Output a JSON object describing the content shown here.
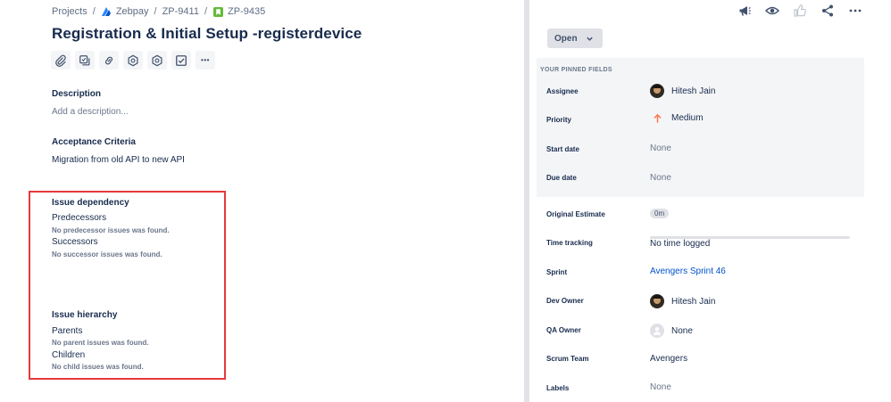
{
  "breadcrumb": {
    "projects": "Projects",
    "project": "Zebpay",
    "parent_key": "ZP-9411",
    "issue_key": "ZP-9435",
    "separator": "/"
  },
  "issue": {
    "title": "Registration & Initial Setup -registerdevice"
  },
  "toolbar": {
    "icons": [
      "paperclip-icon",
      "child-issue-icon",
      "link-icon",
      "hexagon-icon",
      "hexagon-icon",
      "checkbox-icon",
      "more-icon"
    ],
    "more_label": "•••"
  },
  "description": {
    "heading": "Description",
    "placeholder": "Add a description..."
  },
  "acceptance": {
    "heading": "Acceptance Criteria",
    "text": "Migration from old API to new API"
  },
  "dependency": {
    "heading": "Issue dependency",
    "predecessors_label": "Predecessors",
    "predecessors_note": "No predecessor issues was found.",
    "successors_label": "Successors",
    "successors_note": "No successor issues was found."
  },
  "hierarchy": {
    "heading": "Issue hierarchy",
    "parents_label": "Parents",
    "parents_note": "No parent issues was found.",
    "children_label": "Children",
    "children_note": "No child issues was found."
  },
  "header_icons": [
    "megaphone-icon",
    "eye-icon",
    "thumbs-up-icon",
    "share-icon",
    "more-icon"
  ],
  "status": {
    "label": "Open"
  },
  "pinned": {
    "header": "YOUR PINNED FIELDS"
  },
  "fields": {
    "assignee": {
      "label": "Assignee",
      "value": "Hitesh Jain"
    },
    "priority": {
      "label": "Priority",
      "value": "Medium",
      "icon_color": "#ff7452"
    },
    "start_date": {
      "label": "Start date",
      "value": "None"
    },
    "due_date": {
      "label": "Due date",
      "value": "None"
    },
    "original_estimate": {
      "label": "Original Estimate",
      "value": "0m"
    },
    "time_tracking": {
      "label": "Time tracking",
      "value": "No time logged",
      "progress": 0
    },
    "sprint": {
      "label": "Sprint",
      "value": "Avengers Sprint 46"
    },
    "dev_owner": {
      "label": "Dev Owner",
      "value": "Hitesh Jain"
    },
    "qa_owner": {
      "label": "QA Owner",
      "value": "None"
    },
    "scrum_team": {
      "label": "Scrum Team",
      "value": "Avengers"
    },
    "labels": {
      "label": "Labels",
      "value": "None"
    }
  },
  "colors": {
    "text": "#172b4d",
    "muted": "#6b778c",
    "link": "#0052cc",
    "highlight_border": "#e5393b",
    "panel_bg": "#f4f5f7"
  }
}
